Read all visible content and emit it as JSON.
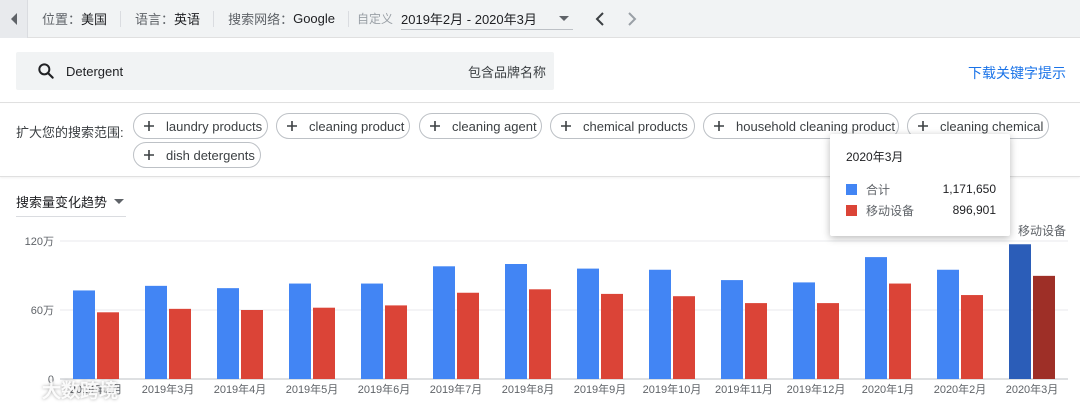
{
  "filters": {
    "location_label": "位置：",
    "location_value": "美国",
    "language_label": "语言：",
    "language_value": "英语",
    "network_label": "搜索网络：",
    "network_value": "Google",
    "date_mode_label": "自定义",
    "date_range": "2019年2月 - 2020年3月"
  },
  "search": {
    "term": "Detergent",
    "brand_toggle_label": "包含品牌名称"
  },
  "download_label": "下载关键字提示",
  "expand": {
    "label": "扩大您的搜索范围:",
    "chips": [
      "laundry products",
      "cleaning product",
      "cleaning agent",
      "chemical products",
      "household cleaning product",
      "cleaning chemical",
      "dish detergents"
    ]
  },
  "trend": {
    "selector_label": "搜索量变化趋势",
    "legend_partial": "移动设备"
  },
  "tooltip": {
    "title": "2020年3月",
    "rows": [
      {
        "name": "合计",
        "value": "1,171,650",
        "color": "#4285f4"
      },
      {
        "name": "移动设备",
        "value": "896,901",
        "color": "#db4437"
      }
    ]
  },
  "chart_data": {
    "type": "bar",
    "ylim": [
      0,
      1200000
    ],
    "yticks": [
      {
        "value": 0,
        "label": "0"
      },
      {
        "value": 600000,
        "label": "60万"
      },
      {
        "value": 1200000,
        "label": "120万"
      }
    ],
    "categories": [
      "2019年2月",
      "2019年3月",
      "2019年4月",
      "2019年5月",
      "2019年6月",
      "2019年7月",
      "2019年8月",
      "2019年9月",
      "2019年10月",
      "2019年11月",
      "2019年12月",
      "2020年1月",
      "2020年2月",
      "2020年3月"
    ],
    "series": [
      {
        "name": "合计",
        "color": "#4285f4",
        "highlight_color": "#2b5db8",
        "values": [
          770000,
          810000,
          790000,
          830000,
          830000,
          980000,
          1000000,
          960000,
          950000,
          860000,
          840000,
          1060000,
          950000,
          1171650
        ]
      },
      {
        "name": "移动设备",
        "color": "#db4437",
        "highlight_color": "#9e2f27",
        "values": [
          580000,
          610000,
          600000,
          620000,
          640000,
          750000,
          780000,
          740000,
          720000,
          660000,
          660000,
          830000,
          730000,
          896901
        ]
      }
    ],
    "highlight_index": 13
  },
  "watermark": {
    "text": "大数跨境"
  }
}
